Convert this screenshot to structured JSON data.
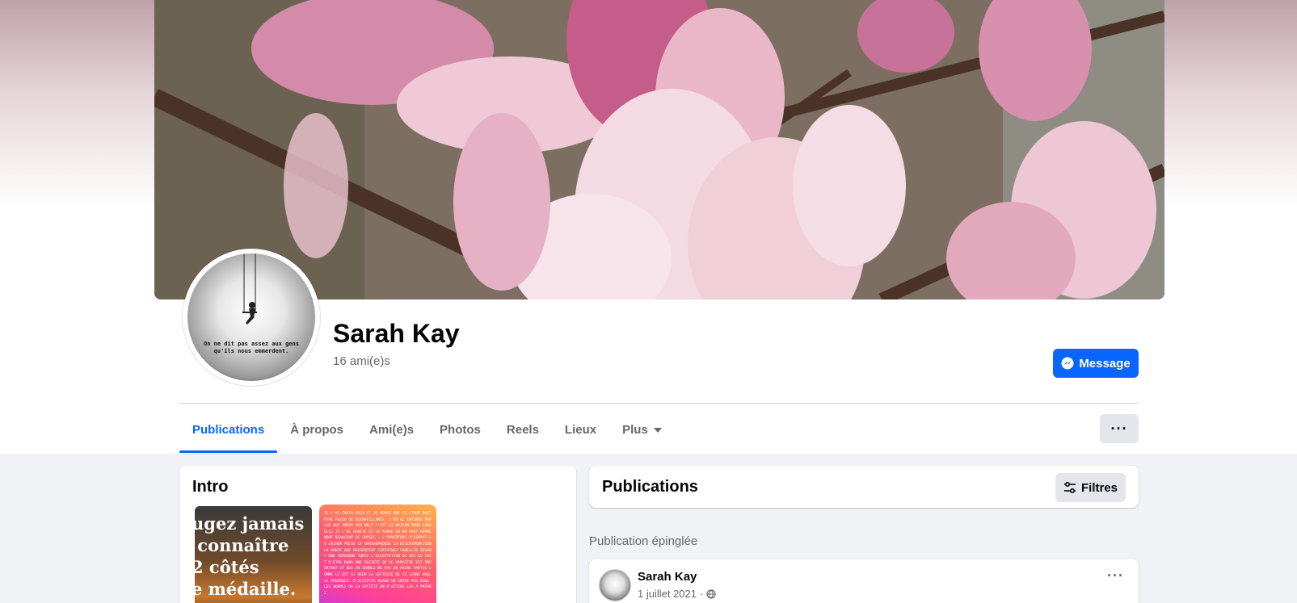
{
  "profile": {
    "name": "Sarah Kay",
    "friends": "16 ami(e)s",
    "avatar_quote": "On ne dit pas assez aux gens qu'ils nous emmerdent."
  },
  "actions": {
    "message_label": "Message",
    "more_label": "···"
  },
  "tabs": [
    {
      "label": "Publications",
      "active": true
    },
    {
      "label": "À propos"
    },
    {
      "label": "Ami(e)s"
    },
    {
      "label": "Photos"
    },
    {
      "label": "Reels"
    },
    {
      "label": "Lieux"
    },
    {
      "label": "Plus"
    }
  ],
  "intro": {
    "title": "Intro",
    "image1_text": "ugez jamais\n connaître\n2 côtés\ne médaille.",
    "image2_text": "Je l'ai enfin reçu et je pense que ce livre doit être plein de bienveillance. J'en ai entendu parler aux infos sur Wolf c'est la raison pour laquelle je l'ai acheté et je pense qu'on peut apprendre beaucoup de choses : l'ouverture d'esprit le lâcher prise la grossophobie la discrimination la honte que ressentent certaines familles devant une personne forte l'acceptation de soi le fait d'être dans une société où le paraître est important et qui en semble ne pas en faire partie comme le dit si bien la lectrice de ce livre quelle prudence: d'accepter quand on entre pas dans les normes de la société on n'attire les a priori"
  },
  "posts": {
    "title": "Publications",
    "filters_label": "Filtres",
    "pinned_label": "Publication épinglée",
    "items": [
      {
        "author": "Sarah Kay",
        "date": "1 juillet 2021",
        "separator": "·"
      }
    ]
  },
  "colors": {
    "accent": "#0866ff",
    "secondary_text": "#65676b",
    "page_bg": "#f0f2f5",
    "button_gray": "#e4e6eb"
  },
  "icons": {
    "message": "messenger-icon",
    "filters": "sliders-icon",
    "audience": "globe-icon",
    "dropdown": "caret-down-icon"
  }
}
